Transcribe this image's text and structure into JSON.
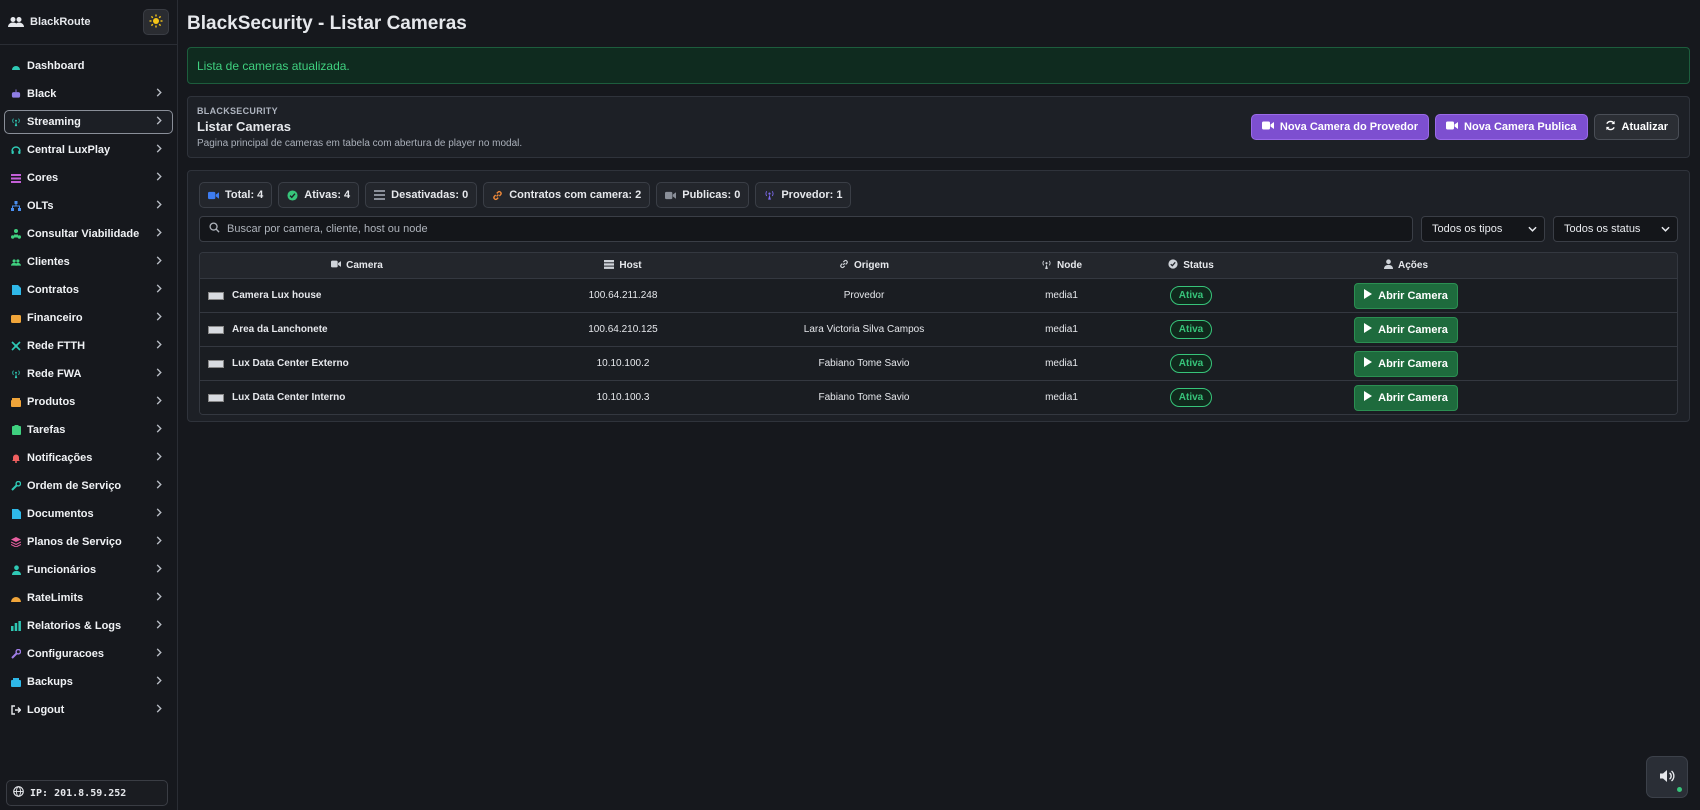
{
  "sidebar": {
    "brand": "BlackRoute",
    "items": [
      {
        "label": "Dashboard",
        "icon": "dashboard-icon",
        "color": "#2fc9b5",
        "chevron": false
      },
      {
        "label": "Black",
        "icon": "robot-icon",
        "color": "#8f7ee6",
        "chevron": true
      },
      {
        "label": "Streaming",
        "icon": "antenna-icon",
        "color": "#2fc9b5",
        "chevron": true,
        "active": true
      },
      {
        "label": "Central LuxPlay",
        "icon": "headset-icon",
        "color": "#2fc9b5",
        "chevron": true
      },
      {
        "label": "Cores",
        "icon": "bars-icon",
        "color": "#c45fd8",
        "chevron": true
      },
      {
        "label": "OLTs",
        "icon": "sitemap-icon",
        "color": "#4a8ff0",
        "chevron": true
      },
      {
        "label": "Consultar Viabilidade",
        "icon": "network-icon",
        "color": "#3fd07f",
        "chevron": true
      },
      {
        "label": "Clientes",
        "icon": "users-icon",
        "color": "#3fd07f",
        "chevron": true
      },
      {
        "label": "Contratos",
        "icon": "document-icon",
        "color": "#2fb8e8",
        "chevron": true
      },
      {
        "label": "Financeiro",
        "icon": "wallet-icon",
        "color": "#f0a53a",
        "chevron": true
      },
      {
        "label": "Rede FTTH",
        "icon": "fiber-icon",
        "color": "#2fc9b5",
        "chevron": true
      },
      {
        "label": "Rede FWA",
        "icon": "antenna-icon",
        "color": "#2fc9b5",
        "chevron": true
      },
      {
        "label": "Produtos",
        "icon": "box-icon",
        "color": "#f0a53a",
        "chevron": true
      },
      {
        "label": "Tarefas",
        "icon": "clipboard-icon",
        "color": "#3fd07f",
        "chevron": true
      },
      {
        "label": "Notificações",
        "icon": "bell-icon",
        "color": "#f06060",
        "chevron": true
      },
      {
        "label": "Ordem de Serviço",
        "icon": "wrench-icon",
        "color": "#2fc9b5",
        "chevron": true
      },
      {
        "label": "Documentos",
        "icon": "file-icon",
        "color": "#2fb8e8",
        "chevron": true
      },
      {
        "label": "Planos de Serviço",
        "icon": "layers-icon",
        "color": "#e85fa0",
        "chevron": true
      },
      {
        "label": "Funcionários",
        "icon": "user-tie-icon",
        "color": "#2fc9b5",
        "chevron": true
      },
      {
        "label": "RateLimits",
        "icon": "gauge-icon",
        "color": "#f0a53a",
        "chevron": true
      },
      {
        "label": "Relatorios & Logs",
        "icon": "chart-icon",
        "color": "#2fc9b5",
        "chevron": true
      },
      {
        "label": "Configuracoes",
        "icon": "tools-icon",
        "color": "#a07ee6",
        "chevron": true
      },
      {
        "label": "Backups",
        "icon": "database-icon",
        "color": "#2fb8e8",
        "chevron": true
      },
      {
        "label": "Logout",
        "icon": "logout-icon",
        "color": "#e6e8ec",
        "chevron": true
      }
    ],
    "ip": "IP: 201.8.59.252"
  },
  "page": {
    "title": "BlackSecurity - Listar Cameras",
    "alert": "Lista de cameras atualizada."
  },
  "header": {
    "kicker": "BLACKSECURITY",
    "title": "Listar Cameras",
    "subtitle": "Pagina principal de cameras em tabela com abertura de player no modal.",
    "btn_provider": "Nova Camera do Provedor",
    "btn_public": "Nova Camera Publica",
    "btn_refresh": "Atualizar"
  },
  "badges": [
    {
      "label": "Total: 4",
      "icon": "video-icon",
      "color": "#3d7cf0"
    },
    {
      "label": "Ativas: 4",
      "icon": "check-circle-icon",
      "color": "#37c47a"
    },
    {
      "label": "Desativadas: 0",
      "icon": "list-icon",
      "color": "#8a8f99"
    },
    {
      "label": "Contratos com camera: 2",
      "icon": "link-icon",
      "color": "#f08a3a"
    },
    {
      "label": "Publicas: 0",
      "icon": "video-icon",
      "color": "#8a8f99"
    },
    {
      "label": "Provedor: 1",
      "icon": "antenna-icon",
      "color": "#7d6bf0"
    }
  ],
  "filters": {
    "search_placeholder": "Buscar por camera, cliente, host ou node",
    "type_select": "Todos os tipos",
    "status_select": "Todos os status"
  },
  "table": {
    "headers": {
      "camera": "Camera",
      "host": "Host",
      "origem": "Origem",
      "node": "Node",
      "status": "Status",
      "acoes": "Ações"
    },
    "rows": [
      {
        "camera": "Camera Lux house",
        "host": "100.64.211.248",
        "origem": "Provedor",
        "node": "media1",
        "status": "Ativa",
        "action": "Abrir Camera"
      },
      {
        "camera": "Area da Lanchonete",
        "host": "100.64.210.125",
        "origem": "Lara Victoria Silva Campos",
        "node": "media1",
        "status": "Ativa",
        "action": "Abrir Camera"
      },
      {
        "camera": "Lux Data Center Externo",
        "host": "10.10.100.2",
        "origem": "Fabiano Tome Savio",
        "node": "media1",
        "status": "Ativa",
        "action": "Abrir Camera"
      },
      {
        "camera": "Lux Data Center Interno",
        "host": "10.10.100.3",
        "origem": "Fabiano Tome Savio",
        "node": "media1",
        "status": "Ativa",
        "action": "Abrir Camera"
      }
    ]
  },
  "colors": {
    "accent_purple": "#7d4fd0",
    "success": "#37c47a",
    "background": "#16181d",
    "card": "#1d2026"
  }
}
